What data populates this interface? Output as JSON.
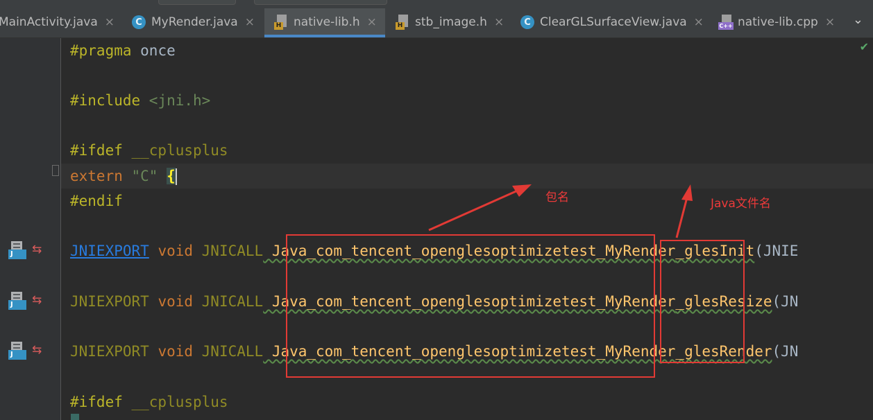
{
  "tabs": [
    {
      "label": "MainActivity.java",
      "icon": "none",
      "active": false
    },
    {
      "label": "MyRender.java",
      "icon": "class-icon",
      "active": false
    },
    {
      "label": "native-lib.h",
      "icon": "header-file-icon",
      "active": true
    },
    {
      "label": "stb_image.h",
      "icon": "header-file-icon",
      "active": false
    },
    {
      "label": "ClearGLSurfaceView.java",
      "icon": "class-icon",
      "active": false
    },
    {
      "label": "native-lib.cpp",
      "icon": "cpp-file-icon",
      "active": false
    }
  ],
  "tab_close_glyph": "×",
  "icon_letters": {
    "class": "C",
    "header": "H",
    "cpp": "C++",
    "jni": "J"
  },
  "code": {
    "line1": {
      "directive": "#pragma",
      "rest": " once"
    },
    "line3": {
      "directive": "#include",
      "header": " <jni.h>"
    },
    "line5": {
      "directive": "#ifdef",
      "macro": " __cplusplus"
    },
    "line6": {
      "kw": "extern",
      "str": " \"C\"",
      "brace": "{"
    },
    "line7": {
      "directive": "#endif"
    },
    "func_lines": [
      {
        "export": "JNIEXPORT",
        "ret": " void",
        "call": " JNICALL",
        "prefix": " Java_com_tencent_opengles​optimizetest_",
        "cls": "MyRender",
        "method": "_glesInit",
        "tail": "(JNIE"
      },
      {
        "export": "JNIEXPORT",
        "ret": " void",
        "call": " JNICALL",
        "prefix": " Java_com_tencent_openglesoptimizetest_",
        "cls": "MyRender",
        "method": "_glesResize",
        "tail": "(JN"
      },
      {
        "export": "JNIEXPORT",
        "ret": " void",
        "call": " JNICALL",
        "prefix": " Java_com_tencent_openglesoptimizetest_",
        "cls": "MyRender",
        "method": "_glesRender",
        "tail": "(JN"
      }
    ],
    "line_last": {
      "directive": "#ifdef",
      "macro": " __cplusplus"
    }
  },
  "annotations": {
    "package_label": "包名",
    "java_file_label": "Java文件名"
  },
  "colors": {
    "annotation_red": "#e23a35",
    "editor_bg": "#2b2b2b",
    "tab_accent": "#4a88c7"
  }
}
